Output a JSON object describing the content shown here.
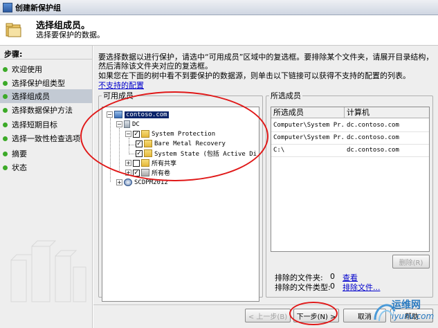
{
  "window": {
    "title": "创建新保护组"
  },
  "header": {
    "title": "选择组成员。",
    "subtitle": "选择要保护的数据。"
  },
  "steps": {
    "heading": "步骤:",
    "items": [
      {
        "label": "欢迎使用"
      },
      {
        "label": "选择保护组类型"
      },
      {
        "label": "选择组成员",
        "selected": true
      },
      {
        "label": "选择数据保护方法"
      },
      {
        "label": "选择短期目标"
      },
      {
        "label": "选择一致性检查选项"
      },
      {
        "label": "摘要"
      },
      {
        "label": "状态"
      }
    ]
  },
  "main": {
    "intro1": "要选择数据以进行保护，请选中“可用成员”区域中的复选框。要排除某个文件夹，请展开目录结构，然后清除该文件夹对应的复选框。",
    "intro2": "如果您在下面的树中看不到要保护的数据源，则单击以下链接可以获得不支持的配置的列表。",
    "unsupported_link": "不支持的配置",
    "available_legend": "可用成员",
    "selected_legend": "所选成员"
  },
  "tree": {
    "domain": "contoso.com",
    "server": "DC",
    "system_protection": "System Protection",
    "bmr": "Bare Metal Recovery",
    "system_state": "System State (包括 Active Di",
    "shares": "所有共享",
    "volumes": "所有卷",
    "dpm": "SCDPM2012"
  },
  "selected_table": {
    "columns": [
      "所选成员",
      "计算机"
    ],
    "rows": [
      {
        "member": "Computer\\System Pr...",
        "computer": "dc.contoso.com"
      },
      {
        "member": "Computer\\System Pr...",
        "computer": "dc.contoso.com"
      },
      {
        "member": "C:\\",
        "computer": "dc.contoso.com"
      }
    ]
  },
  "remove_button": "删除(R)",
  "excluded": {
    "folders_label": "排除的文件夹:",
    "folders_count": "0",
    "folders_link": "查看",
    "types_label": "排除的文件类型:",
    "types_count": "0",
    "types_link": "排除文件..."
  },
  "footer": {
    "back": "< 上一步(B)",
    "next": "下一步(N) >",
    "cancel": "取消",
    "help": "帮助"
  },
  "watermark": {
    "text1": "运维网",
    "text2": "iyunv.com"
  },
  "colors": {
    "step_dot": "#3caa28",
    "annotation": "#e01818",
    "selection": "#0a246a"
  }
}
